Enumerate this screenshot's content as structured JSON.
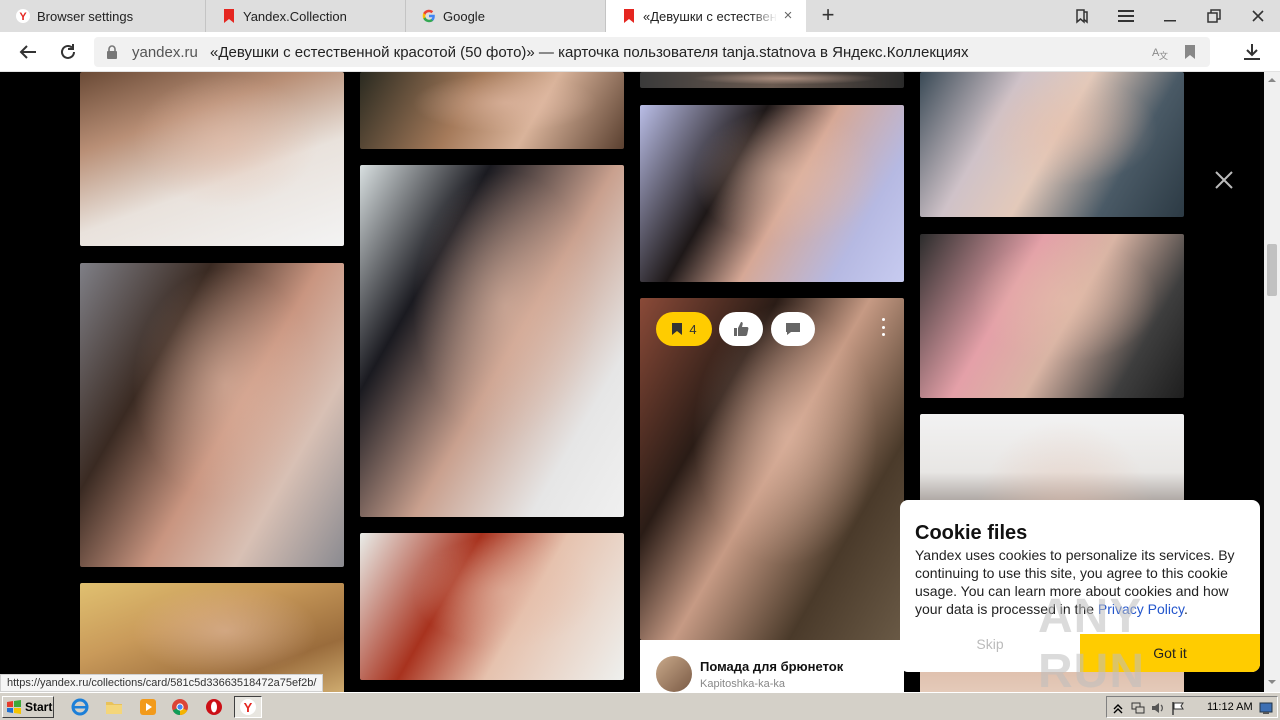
{
  "tabs": [
    {
      "title": "Browser settings",
      "icon": "yandex-y-icon"
    },
    {
      "title": "Yandex.Collection",
      "icon": "collections-bookmark-icon"
    },
    {
      "title": "Google",
      "icon": "google-g-icon"
    },
    {
      "title": "«Девушки с естественной красотой (50 фото)»",
      "icon": "collections-bookmark-icon",
      "active": true
    }
  ],
  "address": {
    "domain": "yandex.ru",
    "title": "«Девушки с естественной красотой (50 фото)» — карточка пользователя tanja.statnova в Яндекс.Коллекциях"
  },
  "card": {
    "pin_count": "4",
    "title": "Помада для брюнеток",
    "user": "Kapitoshka-ka-ka"
  },
  "cookie": {
    "title": "Cookie files",
    "body": "Yandex uses cookies to personalize its services. By continuing to use this site, you agree to this cookie usage. You can learn more about cookies and how your data is processed in the",
    "link": "Privacy Policy",
    "end": ".",
    "skip": "Skip",
    "accept": "Got it"
  },
  "watermark": "ANY RUN",
  "status_url": "https://yandex.ru/collections/card/581c5d33663518472a75ef2b/",
  "taskbar": {
    "start": "Start",
    "clock": "11:12 AM"
  },
  "colors": {
    "accent_yellow": "#ffcc00",
    "tab_red": "#e52620",
    "link_blue": "#2255cc"
  }
}
